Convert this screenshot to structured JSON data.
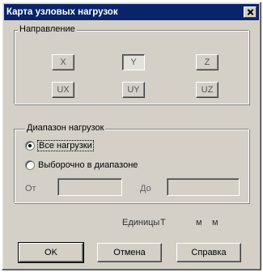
{
  "window": {
    "title": "Карта узловых нагрузок"
  },
  "direction_group": {
    "label": "Направление",
    "buttons": [
      {
        "label": "X",
        "active": false
      },
      {
        "label": "Y",
        "active": true
      },
      {
        "label": "Z",
        "active": false
      },
      {
        "label": "UX",
        "active": false
      },
      {
        "label": "UY",
        "active": false
      },
      {
        "label": "UZ",
        "active": false
      }
    ]
  },
  "range_group": {
    "label": "Диапазон нагрузок",
    "options": [
      {
        "label": "Все нагрузки",
        "checked": true
      },
      {
        "label": "Выборочно в диапазоне",
        "checked": false
      }
    ],
    "from_label": "От",
    "to_label": "До",
    "from_value": "",
    "to_value": ""
  },
  "units": {
    "label": "Единицы",
    "force": "Т",
    "length1": "м",
    "length2": "м"
  },
  "buttons": {
    "ok": "OK",
    "cancel": "Отмена",
    "help": "Справка"
  }
}
